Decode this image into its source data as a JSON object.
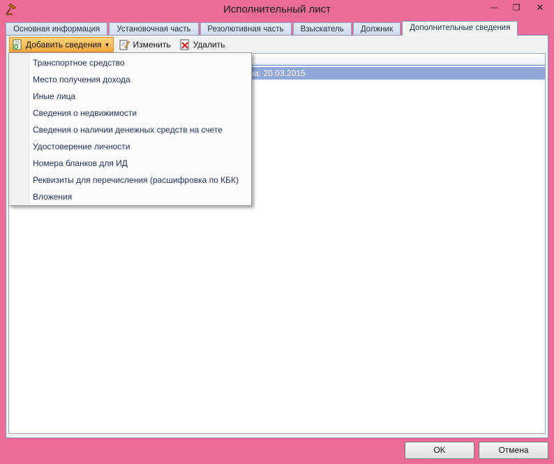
{
  "window": {
    "title": "Исполнительный лист",
    "min_glyph": "—",
    "max_glyph": "❐",
    "close_glyph": "✕"
  },
  "tabs": [
    {
      "label": "Основная информация"
    },
    {
      "label": "Установочная часть"
    },
    {
      "label": "Резолютивная часть"
    },
    {
      "label": "Взыскатель"
    },
    {
      "label": "Должник"
    },
    {
      "label": "Дополнительные сведения",
      "active": true
    }
  ],
  "toolbar": {
    "add_label": "Добавить сведения",
    "dropdown_arrow": "▼",
    "edit_label": "Изменить",
    "delete_label": "Удалить"
  },
  "grid": {
    "selected_row_text": "но на: 20.03.2015"
  },
  "menu": {
    "items": [
      {
        "label": "Транспортное средство"
      },
      {
        "label": "Место получения дохода"
      },
      {
        "label": "Иные лица"
      },
      {
        "label": "Сведения о недвижимости"
      },
      {
        "label": "Сведения о наличии денежных средств на счете"
      },
      {
        "label": "Удостоверение личности"
      },
      {
        "label": "Номера бланков для ИД"
      },
      {
        "label": "Реквизиты для перечисления (расшифровка по КБК)"
      },
      {
        "label": "Вложения"
      }
    ]
  },
  "buttons": {
    "ok_label": "OK",
    "cancel_label": "Отмена"
  },
  "icons": {
    "app": "gavel-icon",
    "add": "add-document-icon",
    "edit": "edit-document-icon",
    "delete": "delete-document-icon"
  },
  "colors": {
    "window_frame": "#ec6b98",
    "selection": "#90a8d8",
    "active_toolbar_button": "#f7a93c"
  }
}
